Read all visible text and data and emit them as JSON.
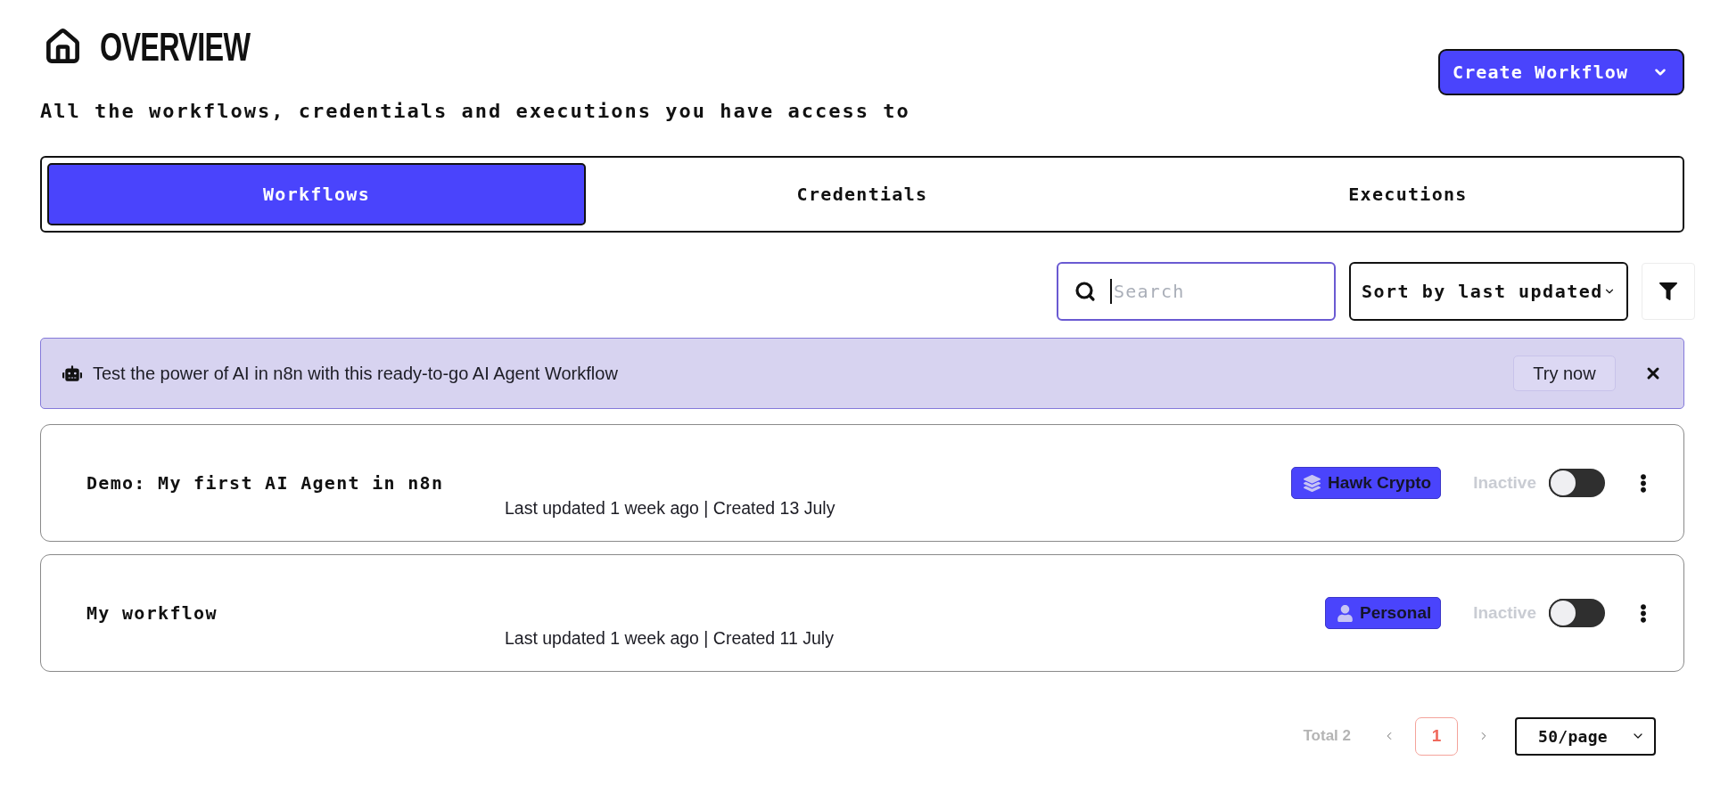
{
  "header": {
    "title": "OVERVIEW",
    "subtitle": "All the workflows, credentials and executions you have access to",
    "create_button": "Create Workflow"
  },
  "tabs": [
    {
      "label": "Workflows",
      "selected": true
    },
    {
      "label": "Credentials",
      "selected": false
    },
    {
      "label": "Executions",
      "selected": false
    }
  ],
  "toolbar": {
    "search": {
      "placeholder": "Search",
      "focused": true
    },
    "sort": "Sort by last updated"
  },
  "banner": {
    "text": "Test the power of AI in n8n with this ready-to-go AI Agent Workflow",
    "button": "Try now"
  },
  "workflows": [
    {
      "name": "Demo: My first AI Agent in n8n",
      "meta": "Last updated 1 week ago | Created 13 July",
      "owner": {
        "kind": "project",
        "label": "Hawk Crypto"
      },
      "status": "Inactive",
      "active": false
    },
    {
      "name": "My workflow",
      "meta": "Last updated 1 week ago | Created 11 July",
      "owner": {
        "kind": "personal",
        "label": "Personal"
      },
      "status": "Inactive",
      "active": false
    }
  ],
  "pagination": {
    "total": "Total 2",
    "pages": [
      {
        "label": "1",
        "selected": true
      }
    ],
    "page_size": "50/page"
  }
}
